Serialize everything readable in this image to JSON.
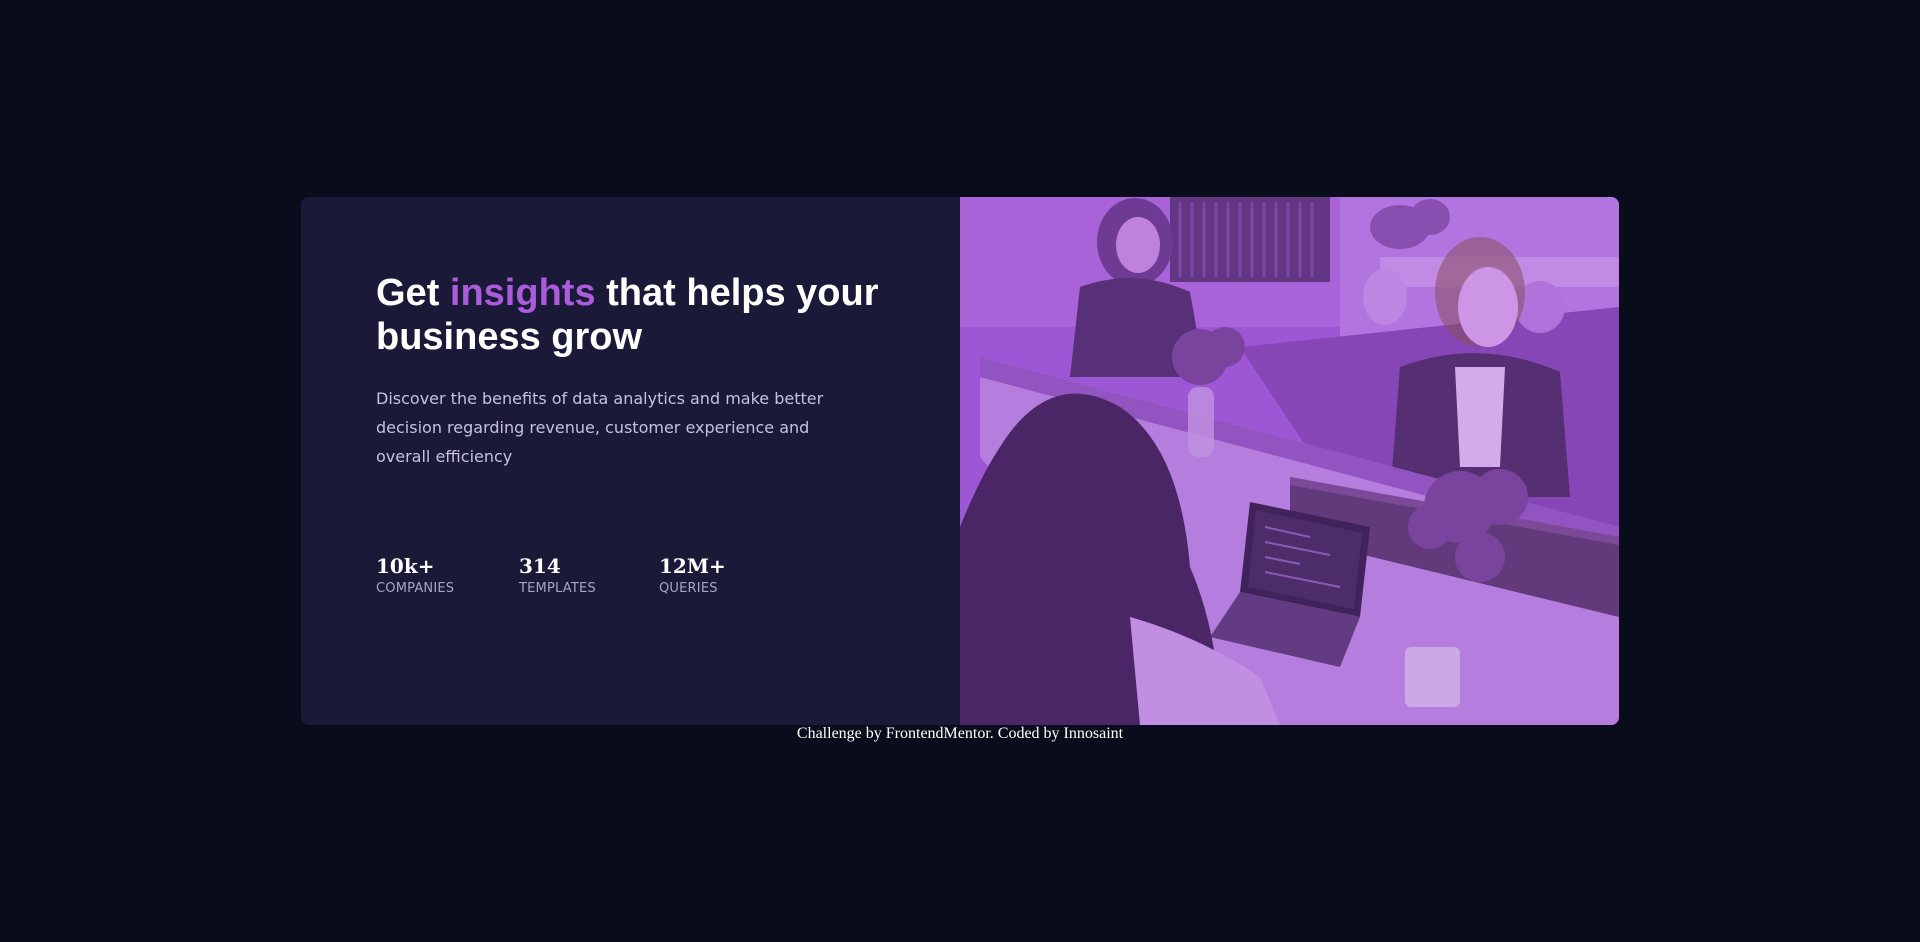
{
  "hero": {
    "title_before": "Get ",
    "title_accent": "insights",
    "title_after": " that helps your business grow",
    "description": "Discover the benefits of data analytics and make better decision regarding revenue, customer experience and overall efficiency"
  },
  "stats": [
    {
      "value": "10k+",
      "label": "COMPANIES"
    },
    {
      "value": "314",
      "label": "TEMPLATES"
    },
    {
      "value": "12M+",
      "label": "QUERIES"
    }
  ],
  "colors": {
    "page_background": "#090c1a",
    "card_background": "#1b1938",
    "accent": "#aa5cdb",
    "image_overlay": "#aa5cdb"
  },
  "image": {
    "subject": "office-team-photo"
  },
  "footer": {
    "attribution": "Challenge by FrontendMentor. Coded by Innosaint"
  }
}
